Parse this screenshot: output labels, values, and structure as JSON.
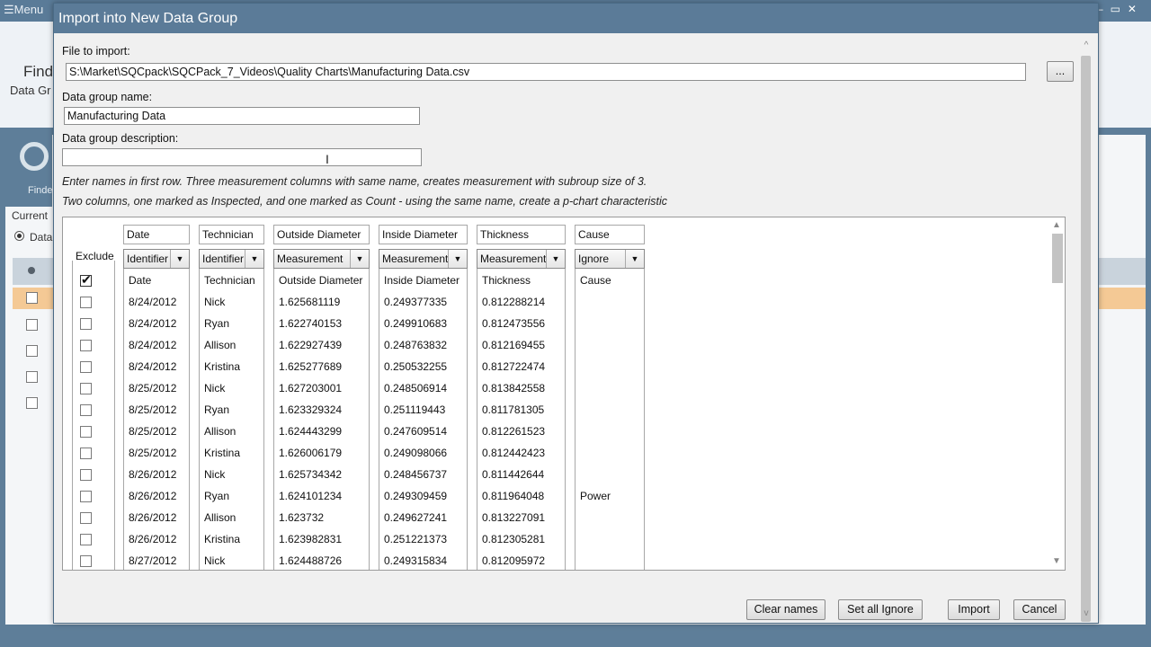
{
  "background": {
    "menu_label": "☰Menu",
    "window_controls": "–▭✕",
    "find_title": "Find",
    "data_group_label": "Data Gr",
    "finder_label": "Finde",
    "current_label": "Current",
    "radio_label": "Data"
  },
  "dialog": {
    "title": "Import into New Data Group",
    "file_label": "File to import:",
    "file_path": "S:\\Market\\SQCpack\\SQCPack_7_Videos\\Quality Charts\\Manufacturing Data.csv",
    "browse_label": "...",
    "name_label": "Data group name:",
    "name_value": "Manufacturing Data",
    "desc_label": "Data group description:",
    "desc_value": "",
    "hint1": "Enter names in first row. Three measurement columns with same name, creates measurement with subroup size of 3.",
    "hint2": "Two columns, one marked as Inspected, and one marked as Count - using the same name, create a p-chart characteristic",
    "buttons": {
      "clear_names": "Clear names",
      "set_all_ignore": "Set all Ignore",
      "import": "Import",
      "cancel": "Cancel"
    }
  },
  "grid": {
    "exclude_label": "Exclude",
    "columns": [
      {
        "name": "Date",
        "type": "Identifier"
      },
      {
        "name": "Technician",
        "type": "Identifier"
      },
      {
        "name": "Outside Diameter",
        "type": "Measurement"
      },
      {
        "name": "Inside Diameter",
        "type": "Measurement"
      },
      {
        "name": "Thickness",
        "type": "Measurement"
      },
      {
        "name": "Cause",
        "type": "Ignore"
      }
    ],
    "rows": [
      {
        "excluded": true,
        "cells": [
          "Date",
          "Technician",
          "Outside Diameter",
          "Inside Diameter",
          "Thickness",
          "Cause"
        ]
      },
      {
        "excluded": false,
        "cells": [
          "8/24/2012",
          "Nick",
          "1.625681119",
          "0.249377335",
          "0.812288214",
          ""
        ]
      },
      {
        "excluded": false,
        "cells": [
          "8/24/2012",
          "Ryan",
          "1.622740153",
          "0.249910683",
          "0.812473556",
          ""
        ]
      },
      {
        "excluded": false,
        "cells": [
          "8/24/2012",
          "Allison",
          "1.622927439",
          "0.248763832",
          "0.812169455",
          ""
        ]
      },
      {
        "excluded": false,
        "cells": [
          "8/24/2012",
          "Kristina",
          "1.625277689",
          "0.250532255",
          "0.812722474",
          ""
        ]
      },
      {
        "excluded": false,
        "cells": [
          "8/25/2012",
          "Nick",
          "1.627203001",
          "0.248506914",
          "0.813842558",
          ""
        ]
      },
      {
        "excluded": false,
        "cells": [
          "8/25/2012",
          "Ryan",
          "1.623329324",
          "0.251119443",
          "0.811781305",
          ""
        ]
      },
      {
        "excluded": false,
        "cells": [
          "8/25/2012",
          "Allison",
          "1.624443299",
          "0.247609514",
          "0.812261523",
          ""
        ]
      },
      {
        "excluded": false,
        "cells": [
          "8/25/2012",
          "Kristina",
          "1.626006179",
          "0.249098066",
          "0.812442423",
          ""
        ]
      },
      {
        "excluded": false,
        "cells": [
          "8/26/2012",
          "Nick",
          "1.625734342",
          "0.248456737",
          "0.811442644",
          ""
        ]
      },
      {
        "excluded": false,
        "cells": [
          "8/26/2012",
          "Ryan",
          "1.624101234",
          "0.249309459",
          "0.811964048",
          "Power"
        ]
      },
      {
        "excluded": false,
        "cells": [
          "8/26/2012",
          "Allison",
          "1.623732",
          "0.249627241",
          "0.813227091",
          ""
        ]
      },
      {
        "excluded": false,
        "cells": [
          "8/26/2012",
          "Kristina",
          "1.623982831",
          "0.251221373",
          "0.812305281",
          ""
        ]
      },
      {
        "excluded": false,
        "cells": [
          "8/27/2012",
          "Nick",
          "1.624488726",
          "0.249315834",
          "0.812095972",
          ""
        ]
      }
    ]
  }
}
